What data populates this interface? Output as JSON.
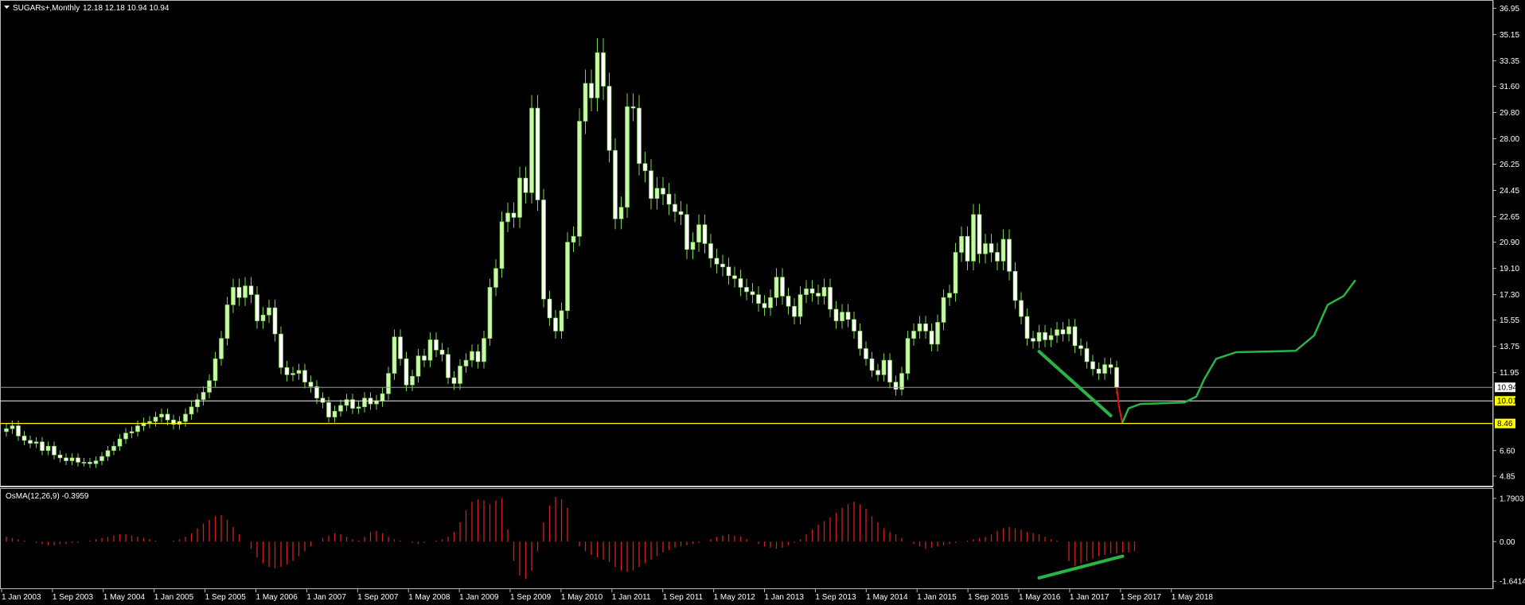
{
  "header": {
    "symbol": "SUGARs+,Monthly",
    "ohlc": "12.18 12.18 10.94 10.94"
  },
  "colors": {
    "background": "#000000",
    "grid": "#5a5a5a",
    "bull_candle": "#c8f7a8",
    "bear_candle": "#ffffff",
    "wick": "#7ad34a",
    "osma": "#d21f1f",
    "trend": "#28b446",
    "drop": "#e11",
    "yellow": "#ffff00"
  },
  "main_axis": {
    "ticks": [
      "36.95",
      "35.15",
      "33.35",
      "31.60",
      "29.80",
      "28.00",
      "26.25",
      "24.45",
      "22.65",
      "20.90",
      "19.10",
      "17.30",
      "15.55",
      "13.75",
      "11.95",
      "6.60",
      "4.85"
    ],
    "range": [
      4.35,
      37.3
    ]
  },
  "price_lines": {
    "current": "10.94",
    "level_1": "10.01",
    "level_2": "8.46"
  },
  "indicator": {
    "label": "OsMA(12,26,9) -0.3959",
    "ticks": [
      "1.7903",
      "0.00",
      "-1.6414"
    ],
    "range": [
      -1.8,
      1.95
    ]
  },
  "time_axis": {
    "labels": [
      "1 Jan 2003",
      "1 Sep 2003",
      "1 May 2004",
      "1 Jan 2005",
      "1 Sep 2005",
      "1 May 2006",
      "1 Jan 2007",
      "1 Sep 2007",
      "1 May 2008",
      "1 Jan 2009",
      "1 Sep 2009",
      "1 May 2010",
      "1 Jan 2011",
      "1 Sep 2011",
      "1 May 2012",
      "1 Jan 2013",
      "1 Sep 2013",
      "1 May 2014",
      "1 Jan 2015",
      "1 Sep 2015",
      "1 May 2016",
      "1 Jan 2017",
      "1 Sep 2017",
      "1 May 2018"
    ]
  },
  "chart_data": {
    "type": "candlestick",
    "frequency": "monthly",
    "start": "2003-01",
    "closes": [
      8.1,
      8.3,
      7.6,
      7.3,
      7.1,
      7.2,
      6.6,
      6.9,
      6.3,
      6.1,
      5.9,
      6.1,
      5.8,
      5.8,
      5.7,
      5.9,
      6.2,
      6.6,
      6.9,
      7.4,
      7.8,
      7.9,
      8.3,
      8.5,
      8.6,
      8.9,
      9.1,
      8.7,
      8.4,
      8.6,
      9.1,
      9.6,
      10.1,
      10.6,
      11.4,
      12.9,
      14.3,
      16.6,
      17.8,
      17.1,
      17.9,
      17.3,
      15.5,
      15.9,
      16.4,
      14.6,
      12.3,
      11.8,
      11.9,
      12.1,
      11.3,
      11.0,
      10.2,
      9.9,
      8.9,
      9.3,
      9.7,
      10.1,
      9.5,
      9.6,
      10.2,
      9.8,
      10.0,
      10.5,
      11.9,
      14.4,
      12.9,
      11.1,
      11.7,
      13.1,
      12.8,
      14.2,
      13.5,
      13.2,
      11.6,
      11.2,
      12.4,
      12.8,
      13.4,
      12.7,
      14.3,
      17.8,
      19.1,
      22.3,
      22.9,
      22.6,
      25.3,
      24.3,
      30.1,
      23.8,
      17.0,
      15.7,
      14.8,
      16.2,
      20.9,
      21.3,
      29.2,
      31.8,
      30.8,
      33.9,
      31.6,
      27.2,
      22.5,
      23.3,
      30.2,
      30.1,
      26.3,
      25.8,
      23.9,
      24.6,
      24.2,
      23.5,
      23.0,
      22.8,
      20.4,
      20.9,
      22.1,
      20.8,
      19.8,
      19.4,
      19.2,
      18.6,
      18.4,
      17.8,
      17.5,
      17.3,
      16.7,
      16.4,
      17.1,
      18.5,
      17.2,
      16.5,
      15.8,
      17.3,
      17.7,
      17.4,
      17.2,
      17.8,
      16.3,
      15.5,
      16.1,
      15.6,
      14.8,
      13.6,
      12.9,
      12.1,
      11.8,
      12.8,
      11.3,
      10.8,
      11.9,
      14.3,
      14.8,
      15.3,
      14.8,
      13.9,
      15.4,
      17.1,
      17.4,
      20.2,
      21.3,
      19.6,
      22.8,
      20.1,
      20.8,
      20.2,
      19.6,
      21.1,
      18.9,
      16.9,
      15.8,
      14.3,
      14.1,
      14.7,
      14.2,
      14.5,
      14.9,
      14.6,
      15.1,
      13.8,
      13.6,
      12.7,
      12.2,
      11.9,
      12.5,
      12.3,
      10.94
    ],
    "osma": [
      0.2,
      0.15,
      0.1,
      0.05,
      0.0,
      -0.05,
      -0.1,
      -0.15,
      -0.15,
      -0.1,
      -0.1,
      -0.05,
      -0.05,
      0.0,
      0.05,
      0.1,
      0.15,
      0.2,
      0.25,
      0.3,
      0.3,
      0.25,
      0.2,
      0.15,
      0.1,
      0.05,
      0.0,
      0.0,
      0.05,
      0.1,
      0.2,
      0.35,
      0.55,
      0.75,
      0.9,
      1.05,
      1.1,
      0.9,
      0.6,
      0.3,
      0.0,
      -0.3,
      -0.65,
      -0.9,
      -1.05,
      -1.1,
      -1.05,
      -0.95,
      -0.8,
      -0.6,
      -0.4,
      -0.2,
      0.0,
      0.15,
      0.25,
      0.35,
      0.3,
      0.2,
      0.1,
      0.05,
      0.2,
      0.4,
      0.45,
      0.35,
      0.2,
      0.1,
      0.05,
      0.0,
      -0.05,
      -0.1,
      -0.05,
      0.0,
      0.05,
      0.1,
      0.2,
      0.4,
      0.8,
      1.3,
      1.65,
      1.75,
      1.7,
      1.55,
      1.7,
      1.8,
      0.5,
      -0.8,
      -1.4,
      -1.55,
      -1.2,
      -0.4,
      0.8,
      1.5,
      1.85,
      1.75,
      1.4,
      0.0,
      -0.2,
      -0.4,
      -0.55,
      -0.65,
      -0.75,
      -0.85,
      -1.05,
      -1.2,
      -1.25,
      -1.2,
      -1.05,
      -0.9,
      -0.75,
      -0.6,
      -0.45,
      -0.35,
      -0.25,
      -0.2,
      -0.15,
      -0.1,
      -0.05,
      0.0,
      0.1,
      0.2,
      0.25,
      0.3,
      0.25,
      0.2,
      0.1,
      0.0,
      -0.1,
      -0.2,
      -0.25,
      -0.3,
      -0.25,
      -0.15,
      -0.05,
      0.1,
      0.3,
      0.5,
      0.7,
      0.85,
      1.0,
      1.2,
      1.4,
      1.55,
      1.65,
      1.55,
      1.35,
      1.05,
      0.8,
      0.55,
      0.4,
      0.3,
      0.15,
      0.0,
      -0.1,
      -0.2,
      -0.3,
      -0.25,
      -0.2,
      -0.15,
      -0.1,
      -0.05,
      0.0,
      0.05,
      0.1,
      0.15,
      0.2,
      0.3,
      0.45,
      0.55,
      0.6,
      0.55,
      0.5,
      0.4,
      0.35,
      0.3,
      0.2,
      0.1,
      0.05,
      0.0,
      -0.8,
      -1.0,
      -0.9,
      -0.8,
      -0.7,
      -0.6,
      -0.55,
      -0.5,
      -0.5,
      -0.45,
      -0.45,
      -0.4
    ]
  }
}
